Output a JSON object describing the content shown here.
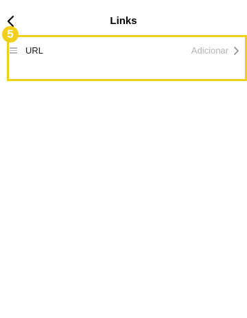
{
  "header": {
    "title": "Links",
    "back_icon": "chevron-left-icon"
  },
  "annotation": {
    "step_number": "5",
    "highlight_color": "#f2cf1b"
  },
  "links_list": {
    "items": [
      {
        "label": "URL",
        "action_text": "Adicionar",
        "handle_icon": "drag-handle-icon",
        "trailing_icon": "chevron-right-icon"
      }
    ]
  }
}
